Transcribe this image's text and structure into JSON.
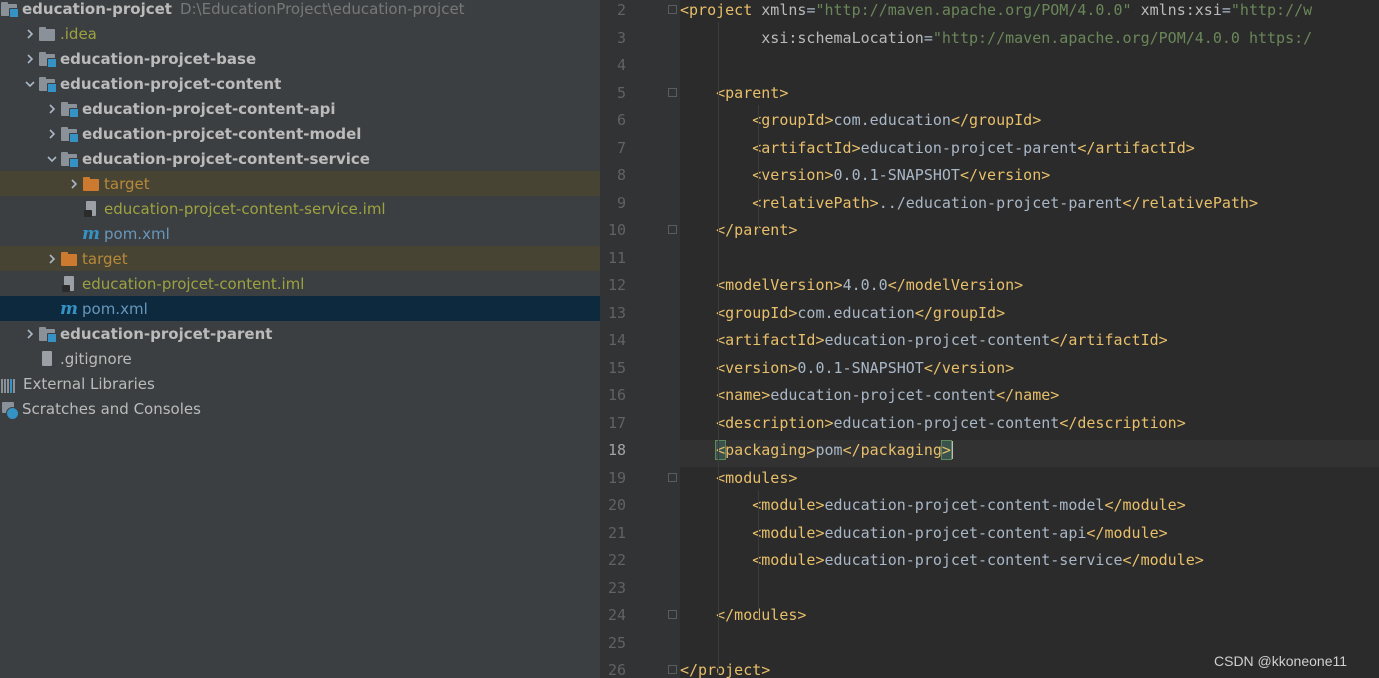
{
  "tree": {
    "root": {
      "name": "education-projcet",
      "path": "D:\\EducationProject\\education-projcet"
    },
    "items": [
      {
        "label": ".idea",
        "type": "folder",
        "style": "olive",
        "expandable": true
      },
      {
        "label": "education-projcet-base",
        "type": "module",
        "style": "bold",
        "expandable": true
      },
      {
        "label": "education-projcet-content",
        "type": "module",
        "style": "bold",
        "expandable": true,
        "expanded": true
      },
      {
        "label": "education-projcet-content-api",
        "type": "module",
        "style": "bold",
        "expandable": true
      },
      {
        "label": "education-projcet-content-model",
        "type": "module",
        "style": "bold",
        "expandable": true
      },
      {
        "label": "education-projcet-content-service",
        "type": "module",
        "style": "bold",
        "expandable": true,
        "expanded": true
      },
      {
        "label": "target",
        "type": "excluded-folder",
        "style": "orange",
        "expandable": true
      },
      {
        "label": "education-projcet-content-service.iml",
        "type": "iml",
        "style": "olive"
      },
      {
        "label": "pom.xml",
        "type": "maven",
        "style": "blue"
      },
      {
        "label": "target",
        "type": "excluded-folder",
        "style": "orange",
        "expandable": true
      },
      {
        "label": "education-projcet-content.iml",
        "type": "iml",
        "style": "olive"
      },
      {
        "label": "pom.xml",
        "type": "maven",
        "style": "blue",
        "selected": true
      },
      {
        "label": "education-projcet-parent",
        "type": "module",
        "style": "bold",
        "expandable": true
      },
      {
        "label": ".gitignore",
        "type": "gitignore",
        "style": "normal"
      },
      {
        "label": "External Libraries",
        "type": "libraries",
        "style": "normal"
      },
      {
        "label": "Scratches and Consoles",
        "type": "scratches",
        "style": "normal"
      }
    ]
  },
  "editor": {
    "current_line": 18,
    "lines": [
      {
        "n": 2,
        "text": "<project xmlns=\"http://maven.apache.org/POM/4.0.0\" xmlns:xsi=\"http://w"
      },
      {
        "n": 3,
        "text": "         xsi:schemaLocation=\"http://maven.apache.org/POM/4.0.0 https:/"
      },
      {
        "n": 4,
        "text": ""
      },
      {
        "n": 5,
        "text": "    <parent>"
      },
      {
        "n": 6,
        "text": "        <groupId>com.education</groupId>"
      },
      {
        "n": 7,
        "text": "        <artifactId>education-projcet-parent</artifactId>"
      },
      {
        "n": 8,
        "text": "        <version>0.0.1-SNAPSHOT</version>"
      },
      {
        "n": 9,
        "text": "        <relativePath>../education-projcet-parent</relativePath>"
      },
      {
        "n": 10,
        "text": "    </parent>"
      },
      {
        "n": 11,
        "text": ""
      },
      {
        "n": 12,
        "text": "    <modelVersion>4.0.0</modelVersion>"
      },
      {
        "n": 13,
        "text": "    <groupId>com.education</groupId>"
      },
      {
        "n": 14,
        "text": "    <artifactId>education-projcet-content</artifactId>"
      },
      {
        "n": 15,
        "text": "    <version>0.0.1-SNAPSHOT</version>"
      },
      {
        "n": 16,
        "text": "    <name>education-projcet-content</name>"
      },
      {
        "n": 17,
        "text": "    <description>education-projcet-content</description>"
      },
      {
        "n": 18,
        "text": "    <packaging>pom</packaging>"
      },
      {
        "n": 19,
        "text": "    <modules>"
      },
      {
        "n": 20,
        "text": "        <module>education-projcet-content-model</module>"
      },
      {
        "n": 21,
        "text": "        <module>education-projcet-content-api</module>"
      },
      {
        "n": 22,
        "text": "        <module>education-projcet-content-service</module>"
      },
      {
        "n": 23,
        "text": ""
      },
      {
        "n": 24,
        "text": "    </modules>"
      },
      {
        "n": 25,
        "text": ""
      },
      {
        "n": 26,
        "text": "</project>"
      }
    ]
  },
  "watermark": "CSDN @kkoneone11",
  "colors": {
    "tree_bg": "#3c3f41",
    "editor_bg": "#2b2b2b",
    "tag": "#e8bf6a",
    "string": "#6a8759",
    "text": "#a9b7c6",
    "selection": "#0d293e"
  }
}
